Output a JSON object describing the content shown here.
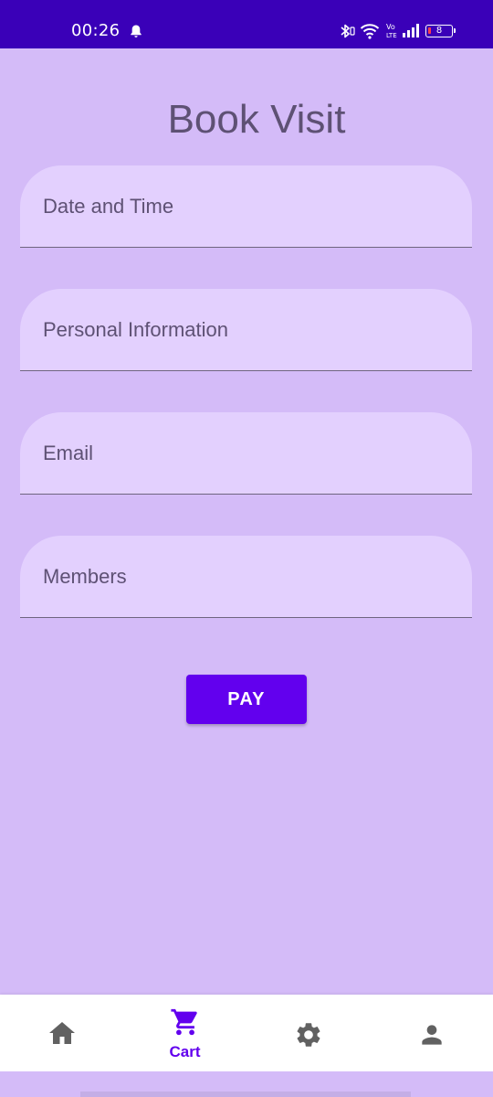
{
  "status_bar": {
    "time": "00:26",
    "battery_level": "8",
    "icons": [
      "bell-icon",
      "bluetooth-icon",
      "wifi-icon",
      "volte-icon",
      "signal-icon",
      "battery-icon"
    ],
    "background_color": "#3a00b8"
  },
  "page": {
    "title": "Book Visit",
    "background_color": "#d4bbf8"
  },
  "form": {
    "fields": [
      {
        "label": "Date and Time"
      },
      {
        "label": "Personal Information"
      },
      {
        "label": "Email"
      },
      {
        "label": "Members"
      }
    ],
    "submit_label": "PAY",
    "accent_color": "#6200ee",
    "field_color": "#e3d0fe"
  },
  "bottom_nav": {
    "items": [
      {
        "icon": "home-icon",
        "label": ""
      },
      {
        "icon": "cart-icon",
        "label": "Cart",
        "selected": true
      },
      {
        "icon": "gear-icon",
        "label": ""
      },
      {
        "icon": "person-icon",
        "label": ""
      }
    ],
    "active_color": "#6200ee",
    "inactive_color": "#616161"
  }
}
